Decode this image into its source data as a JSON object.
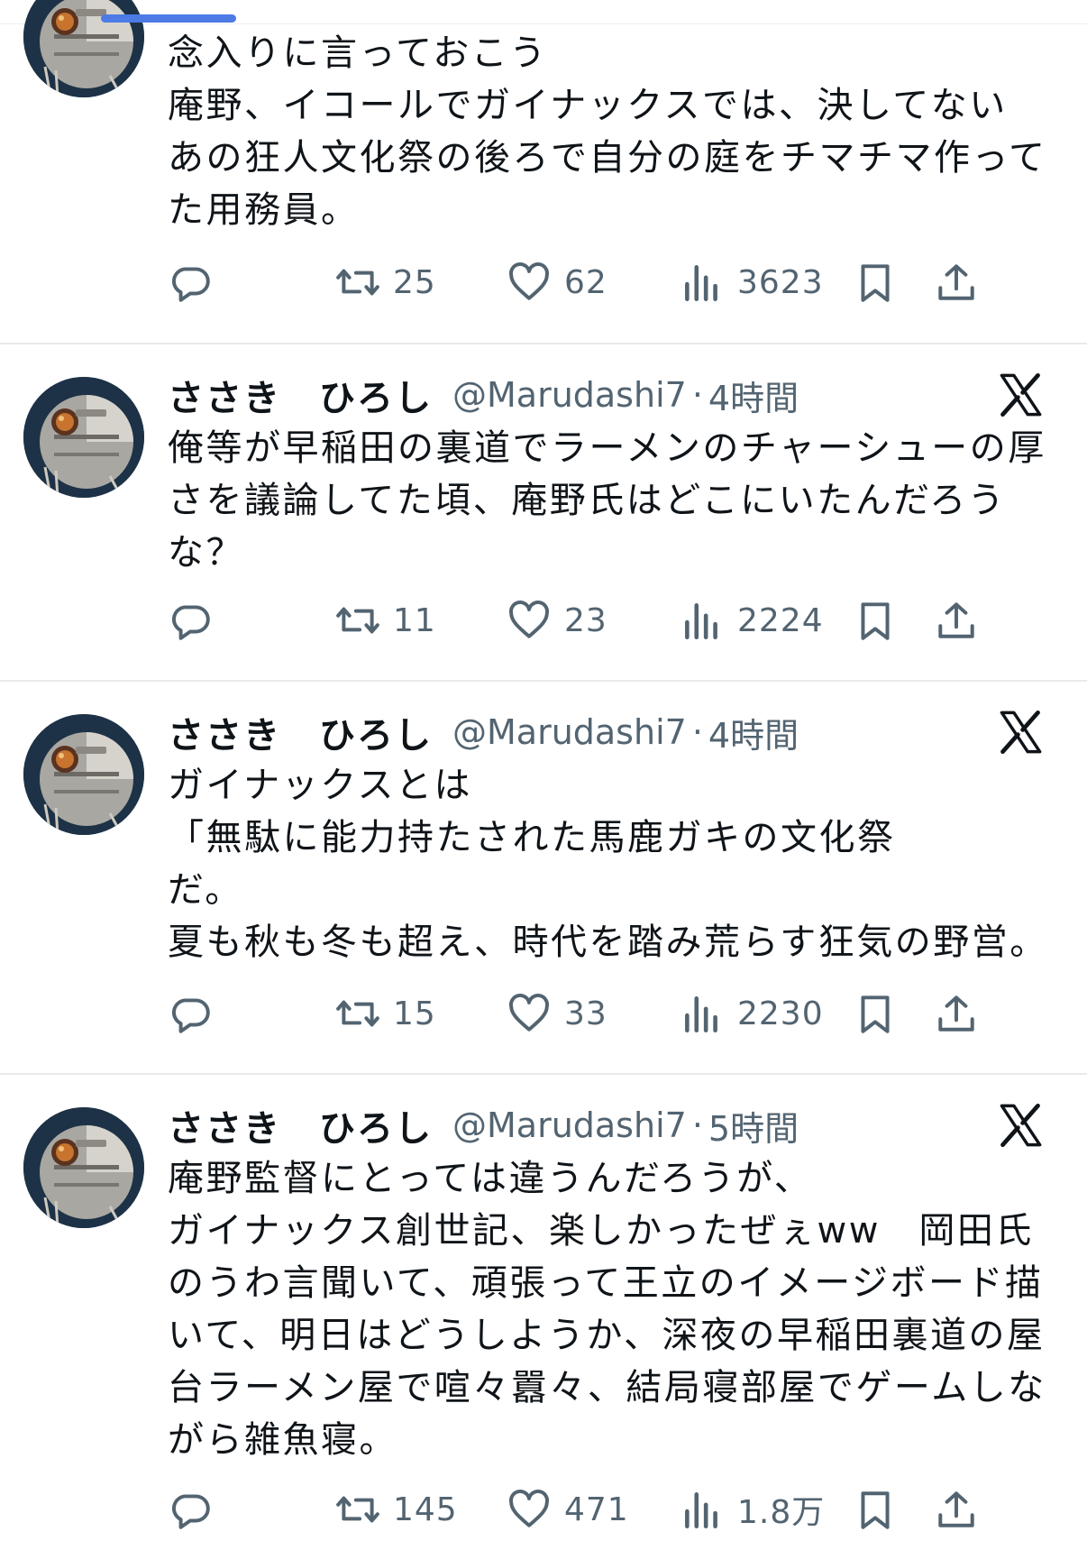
{
  "author": {
    "name": "ささき　ひろし",
    "handle": "@Marudashi7"
  },
  "separator": "·",
  "tweets": [
    {
      "text": "念入りに言っておこう\n庵野、イコールでガイナックスでは、決してない\nあの狂人文化祭の後ろで自分の庭をチマチマ作ってた用務員。",
      "stats": {
        "replies": "",
        "retweets": "25",
        "likes": "62",
        "views": "3623"
      }
    },
    {
      "time": "4時間",
      "text": "俺等が早稲田の裏道でラーメンのチャーシューの厚さを議論してた頃、庵野氏はどこにいたんだろうな？",
      "stats": {
        "replies": "",
        "retweets": "11",
        "likes": "23",
        "views": "2224"
      }
    },
    {
      "time": "4時間",
      "text": "ガイナックスとは\n「無駄に能力持たされた馬鹿ガキの文化祭\nだ。\n夏も秋も冬も超え、時代を踏み荒らす狂気の野営。",
      "stats": {
        "replies": "",
        "retweets": "15",
        "likes": "33",
        "views": "2230"
      }
    },
    {
      "time": "5時間",
      "text": "庵野監督にとっては違うんだろうが、\nガイナックス創世記、楽しかったぜぇww　岡田氏のうわ言聞いて、頑張って王立のイメージボード描いて、明日はどうしようか、深夜の早稲田裏道の屋台ラーメン屋で喧々囂々、結局寝部屋でゲームしながら雑魚寝。",
      "stats": {
        "replies": "",
        "retweets": "145",
        "likes": "471",
        "views": "1.8万"
      }
    }
  ],
  "icons": {
    "reply": "reply-icon",
    "retweet": "retweet-icon",
    "like": "heart-icon",
    "views": "views-icon",
    "bookmark": "bookmark-icon",
    "share": "share-icon",
    "platform": "x-logo-icon"
  },
  "colors": {
    "text": "#0f1419",
    "secondary": "#536471",
    "divider": "#e7eaec",
    "scroll_indicator": "#4c7be6"
  }
}
